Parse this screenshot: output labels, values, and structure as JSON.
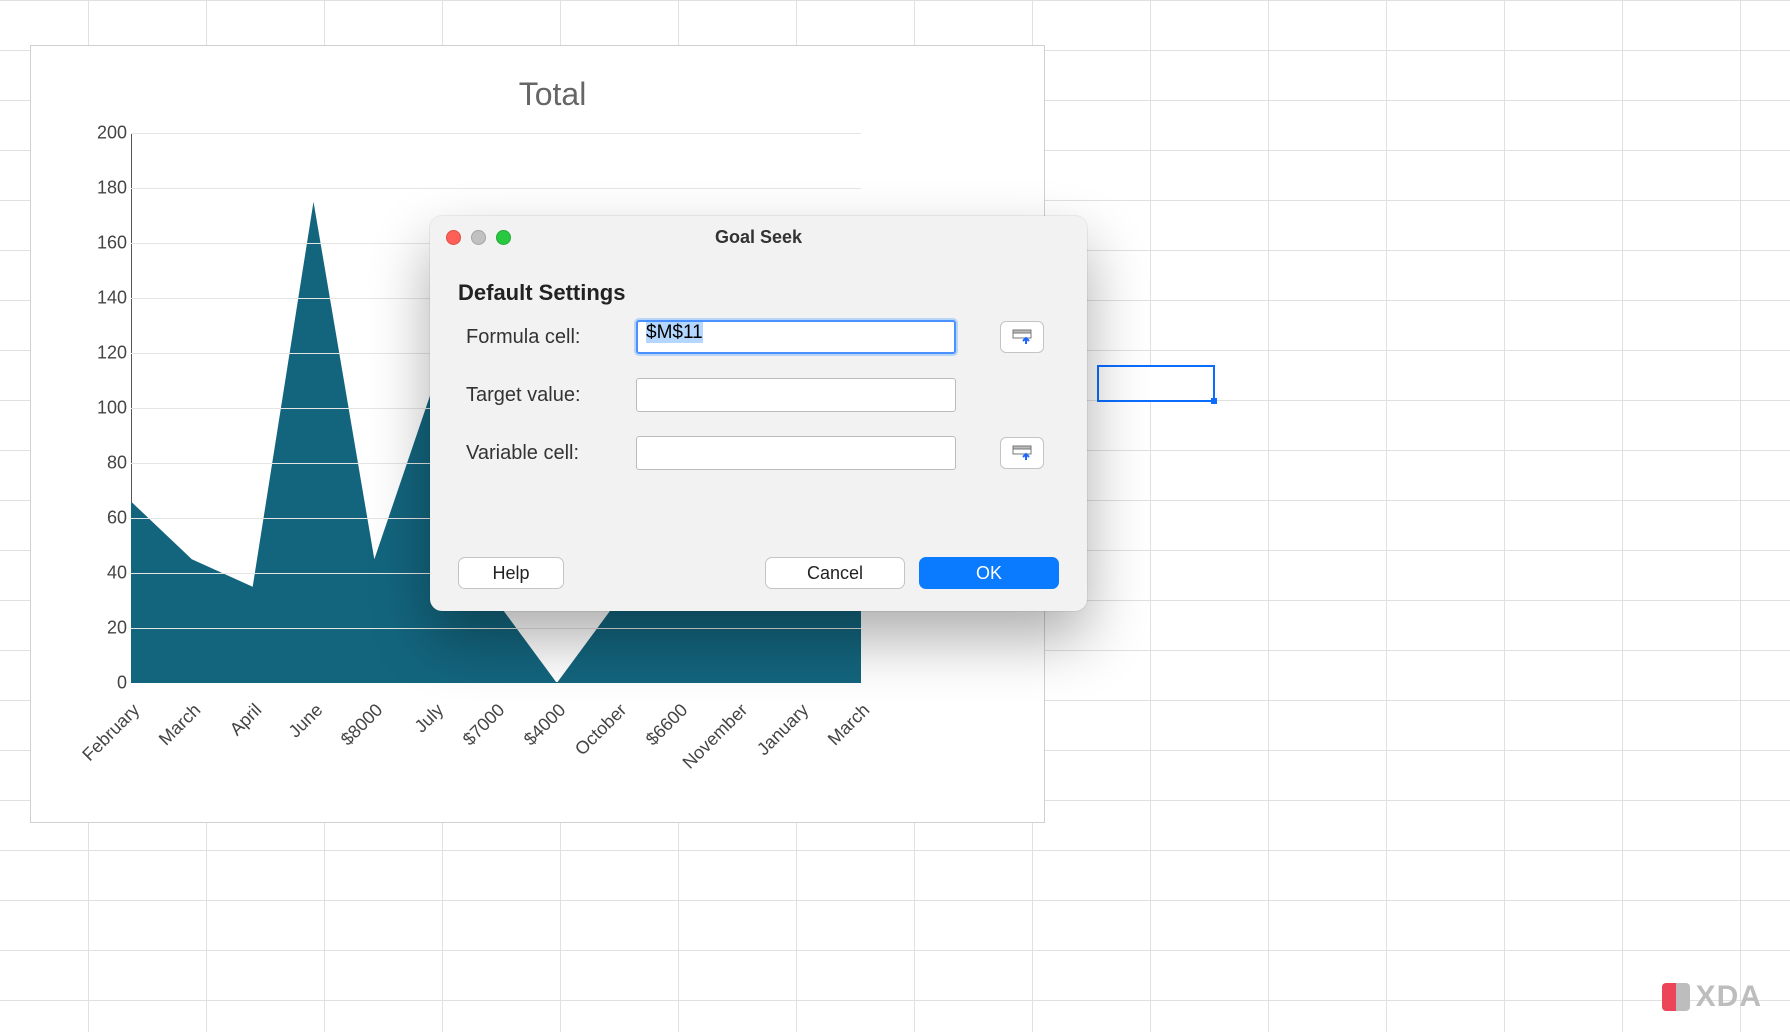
{
  "chart_data": {
    "type": "area",
    "title": "Total",
    "ylim": [
      0,
      200
    ],
    "yticks": [
      0,
      20,
      40,
      60,
      80,
      100,
      120,
      140,
      160,
      180,
      200
    ],
    "categories": [
      "February",
      "March",
      "April",
      "June",
      "$8000",
      "July",
      "$7000",
      "$4000",
      "October",
      "$6600",
      "November",
      "January",
      "March"
    ],
    "values": [
      66,
      45,
      35,
      175,
      45,
      110,
      30,
      0,
      30,
      45,
      35,
      42,
      38
    ]
  },
  "selected_cell": {
    "ref": "$M$11"
  },
  "dialog": {
    "title": "Goal Seek",
    "section": "Default Settings",
    "fields": {
      "formula_cell": {
        "label": "Formula cell:",
        "value": "$M$11"
      },
      "target_value": {
        "label": "Target value:",
        "value": ""
      },
      "variable_cell": {
        "label": "Variable cell:",
        "value": ""
      }
    },
    "buttons": {
      "help": "Help",
      "cancel": "Cancel",
      "ok": "OK"
    }
  },
  "watermark": "XDA"
}
